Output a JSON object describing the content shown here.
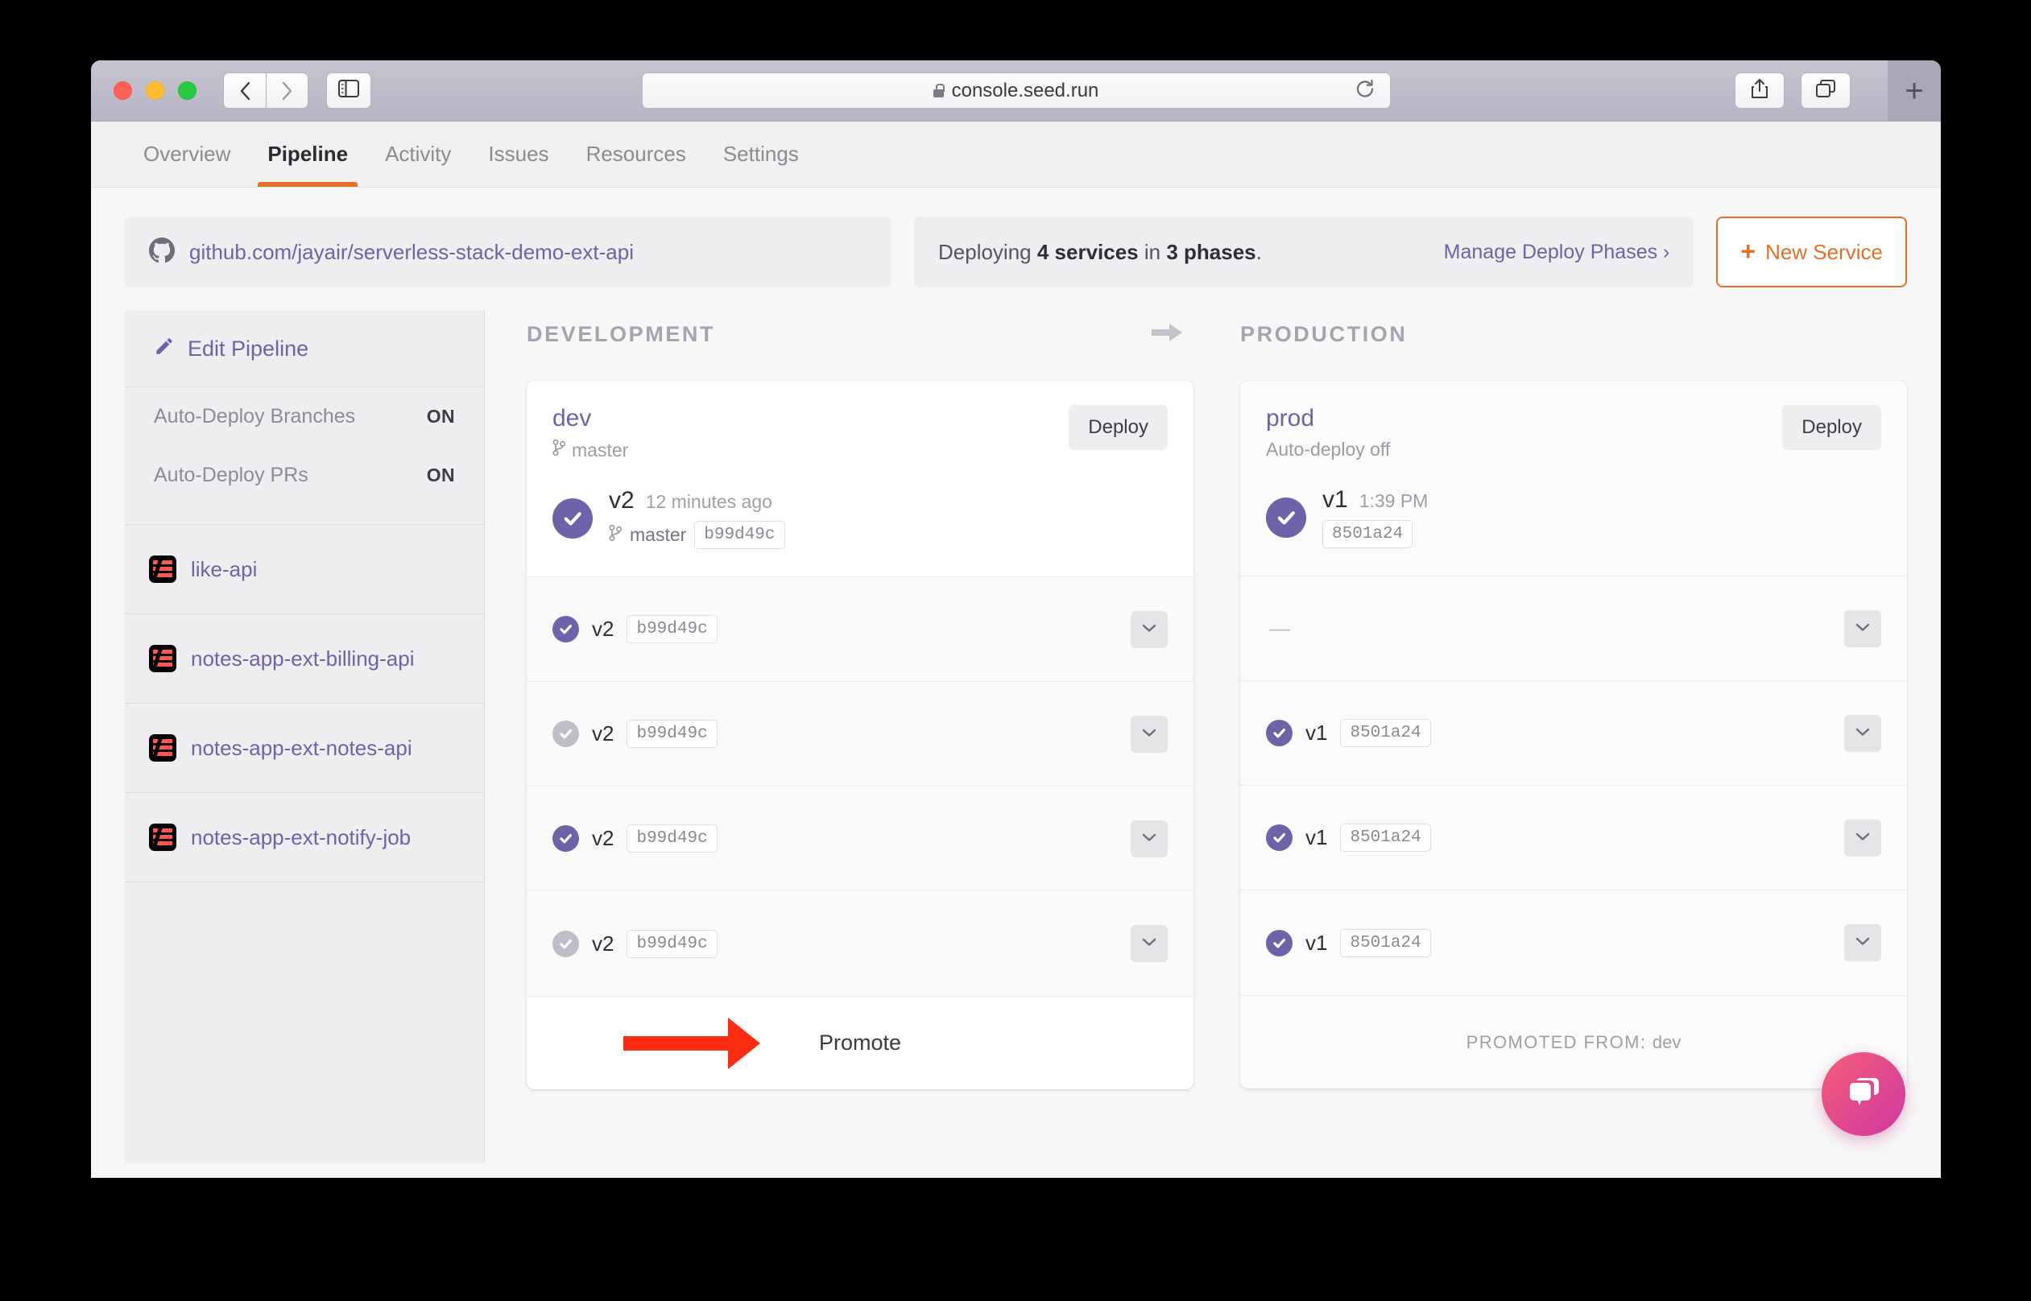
{
  "browser": {
    "url": "console.seed.run",
    "lock_icon": "lock-icon",
    "back_icon": "chevron-left-icon",
    "forward_icon": "chevron-right-icon",
    "sidebar_icon": "sidebar-toggle-icon",
    "reload_icon": "reload-icon",
    "share_icon": "share-icon",
    "tabs_icon": "copy-tabs-icon",
    "new_tab_label": "+"
  },
  "app_tabs": [
    {
      "label": "Overview",
      "active": false
    },
    {
      "label": "Pipeline",
      "active": true
    },
    {
      "label": "Activity",
      "active": false
    },
    {
      "label": "Issues",
      "active": false
    },
    {
      "label": "Resources",
      "active": false
    },
    {
      "label": "Settings",
      "active": false
    }
  ],
  "subheader": {
    "repo_icon": "github-icon",
    "repo": "github.com/jayair/serverless-stack-demo-ext-api",
    "deploy_prefix": "Deploying ",
    "deploy_services": "4 services",
    "deploy_mid": " in ",
    "deploy_phases": "3 phases",
    "deploy_suffix": ".",
    "manage_link": "Manage Deploy Phases ›",
    "new_service_label": "New Service",
    "new_service_plus": "+"
  },
  "sidebar": {
    "edit_pipeline": "Edit Pipeline",
    "edit_icon": "pencil-icon",
    "settings": [
      {
        "label": "Auto-Deploy Branches",
        "value": "ON"
      },
      {
        "label": "Auto-Deploy PRs",
        "value": "ON"
      }
    ],
    "services": [
      {
        "name": "like-api",
        "icon": "serverless-icon"
      },
      {
        "name": "notes-app-ext-billing-api",
        "icon": "serverless-icon"
      },
      {
        "name": "notes-app-ext-notes-api",
        "icon": "serverless-icon"
      },
      {
        "name": "notes-app-ext-notify-job",
        "icon": "serverless-icon"
      }
    ]
  },
  "stages": {
    "arrow_icon": "arrow-right-icon",
    "development": {
      "header": "DEVELOPMENT",
      "stage_name": "dev",
      "branch_icon": "git-branch-icon",
      "branch": "master",
      "deploy_button": "Deploy",
      "version": {
        "number": "v2",
        "time": "12 minutes ago",
        "branch": "master",
        "commit": "b99d49c",
        "status": "success"
      },
      "services": [
        {
          "version": "v2",
          "commit": "b99d49c",
          "status": "success",
          "chevron": "chevron-down-icon"
        },
        {
          "version": "v2",
          "commit": "b99d49c",
          "status": "inactive",
          "chevron": "chevron-down-icon"
        },
        {
          "version": "v2",
          "commit": "b99d49c",
          "status": "success",
          "chevron": "chevron-down-icon"
        },
        {
          "version": "v2",
          "commit": "b99d49c",
          "status": "inactive",
          "chevron": "chevron-down-icon"
        }
      ],
      "footer_label": "Promote"
    },
    "production": {
      "header": "PRODUCTION",
      "stage_name": "prod",
      "subtitle": "Auto-deploy off",
      "deploy_button": "Deploy",
      "version": {
        "number": "v1",
        "time": "1:39 PM",
        "commit": "8501a24",
        "status": "success"
      },
      "services": [
        {
          "version": "",
          "commit": "",
          "status": "empty",
          "placeholder": "—",
          "chevron": "chevron-down-icon"
        },
        {
          "version": "v1",
          "commit": "8501a24",
          "status": "success",
          "chevron": "chevron-down-icon"
        },
        {
          "version": "v1",
          "commit": "8501a24",
          "status": "success",
          "chevron": "chevron-down-icon"
        },
        {
          "version": "v1",
          "commit": "8501a24",
          "status": "success",
          "chevron": "chevron-down-icon"
        }
      ],
      "footer_label_prefix": "PROMOTED FROM: ",
      "footer_stage": "dev"
    }
  },
  "chat": {
    "icon": "chat-bubble-icon"
  },
  "annotation": {
    "icon": "red-arrow-icon",
    "points_at": "Promote"
  },
  "colors": {
    "accent_orange": "#e27127",
    "purple": "#6e62a8",
    "red_arrow": "#fc2d12",
    "chat_pink": "#e0488f"
  }
}
